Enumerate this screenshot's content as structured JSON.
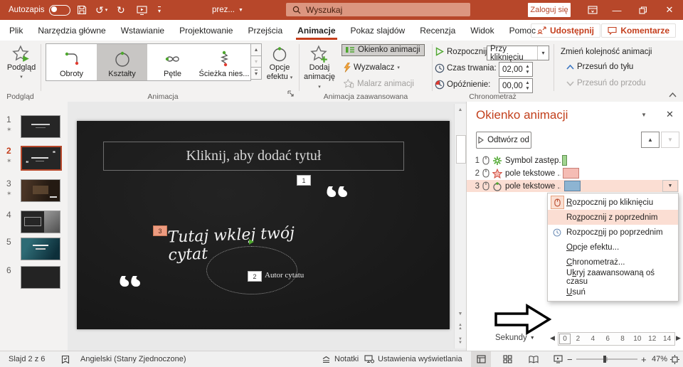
{
  "titlebar": {
    "autosave_label": "Autozapis",
    "doc_title": "prez...",
    "search_placeholder": "Wyszukaj",
    "sign_in_label": "Zaloguj się"
  },
  "menubar": {
    "tabs": [
      "Plik",
      "Narzędzia główne",
      "Wstawianie",
      "Projektowanie",
      "Przejścia",
      "Animacje",
      "Pokaz slajdów",
      "Recenzja",
      "Widok",
      "Pomoc"
    ],
    "active_tab": "Animacje",
    "share_label": "Udostępnij",
    "comments_label": "Komentarze"
  },
  "ribbon": {
    "preview_label": "Podgląd",
    "preview_group": "Podgląd",
    "gallery": [
      "Obroty",
      "Kształty",
      "Pętle",
      "Ścieżka nies..."
    ],
    "gallery_selected": "Kształty",
    "effect_options_line1": "Opcje",
    "effect_options_line2": "efektu",
    "animation_group": "Animacja",
    "add_line1": "Dodaj",
    "add_line2": "animację",
    "pane_button_label": "Okienko animacji",
    "trigger_label": "Wyzwalacz",
    "painter_label": "Malarz animacji",
    "advanced_group": "Animacja zaawansowana",
    "start_label": "Rozpocznij:",
    "start_value": "Przy kliknięciu",
    "duration_label": "Czas trwania:",
    "duration_value": "02,00",
    "delay_label": "Opóźnienie:",
    "delay_value": "00,00",
    "reorder_label": "Zmień kolejność animacji",
    "move_earlier_label": "Przesuń do tyłu",
    "move_later_label": "Przesuń do przodu",
    "timing_group": "Chronometraż"
  },
  "thumbnails": [
    {
      "num": "1",
      "animated": true,
      "selected": false
    },
    {
      "num": "2",
      "animated": true,
      "selected": true
    },
    {
      "num": "3",
      "animated": true,
      "selected": false
    },
    {
      "num": "4",
      "animated": false,
      "selected": false
    },
    {
      "num": "5",
      "animated": false,
      "selected": false
    },
    {
      "num": "6",
      "animated": false,
      "selected": false
    }
  ],
  "slide": {
    "title_placeholder": "Kliknij, aby dodać tytuł",
    "quote_text": "Tutaj wklej twój cytat",
    "author_text": "Autor cytatu",
    "badge_1": "1",
    "badge_2": "2",
    "badge_3": "3"
  },
  "animation_pane": {
    "title": "Okienko animacji",
    "play_label": "Odtwórz od",
    "items": [
      {
        "num": "1",
        "label": "Symbol zastęp...",
        "effect": "entrance-green-star",
        "bar_color": "#A1D490"
      },
      {
        "num": "2",
        "label": "pole tekstowe ...",
        "effect": "emphasis-red-star",
        "bar_color": "#F5BCB4"
      },
      {
        "num": "3",
        "label": "pole tekstowe ...",
        "effect": "motion-path-circle",
        "bar_color": "#8DB4D2",
        "selected": true
      }
    ],
    "seconds_label": "Sekundy",
    "ticks": [
      "0",
      "2",
      "4",
      "6",
      "8",
      "10",
      "12",
      "14"
    ]
  },
  "context_menu": {
    "items": [
      {
        "label": "Rozpocznij po kliknięciu",
        "accel": 0,
        "icon": "mouse",
        "current": true
      },
      {
        "label": "Rozpocznij z poprzednim",
        "accel": 2,
        "highlighted": true
      },
      {
        "label": "Rozpocznij po poprzednim",
        "accel": 7,
        "icon": "clock"
      },
      {
        "label": "Opcje efektu...",
        "accel": 0
      },
      {
        "label": "Chronometraż...",
        "accel": 0
      },
      {
        "label": "Ukryj zaawansowaną oś czasu",
        "accel": 1
      },
      {
        "label": "Usuń",
        "accel": 0
      }
    ]
  },
  "statusbar": {
    "slide_info": "Slajd 2 z 6",
    "language": "Angielski (Stany Zjednoczone)",
    "notes_label": "Notatki",
    "display_label": "Ustawienia wyświetlania",
    "zoom_value": "47%"
  },
  "colors": {
    "brand": "#B7472A",
    "accent_red": "#C43E1C",
    "search_field": "#DC9680",
    "selection_pink": "#FBDED3",
    "bar_green": "#A1D490",
    "bar_pink": "#F5BCB4",
    "bar_blue": "#8DB4D2",
    "slide_background": "#1B1B1B"
  }
}
